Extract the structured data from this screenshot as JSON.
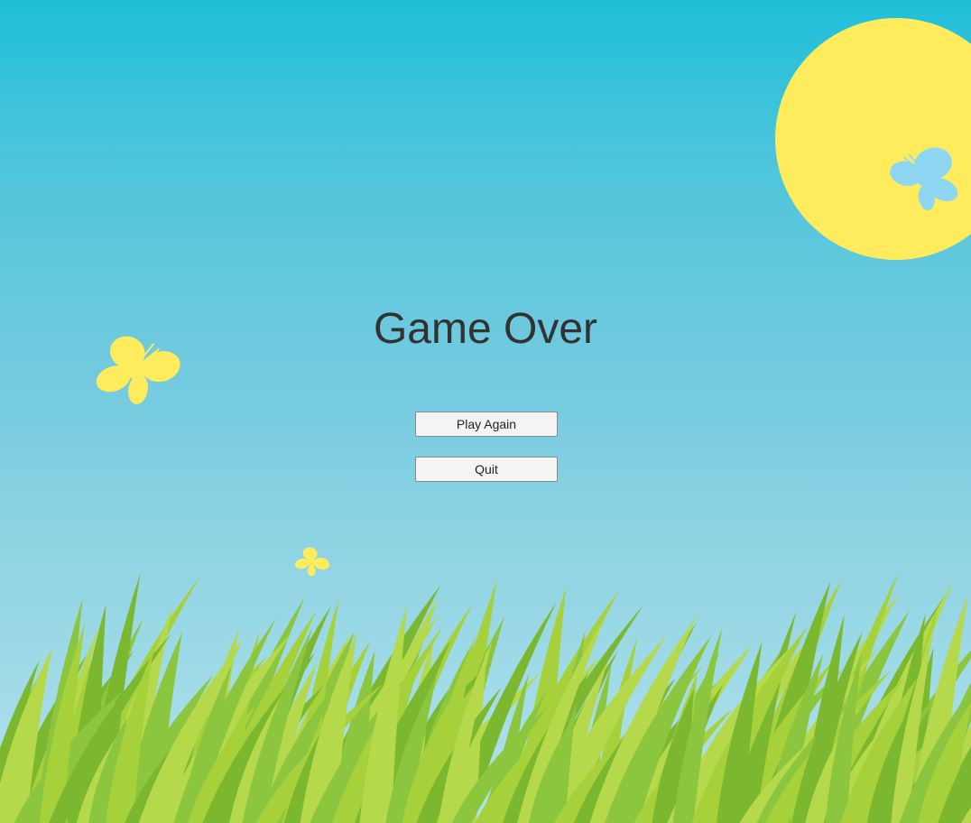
{
  "screen": {
    "title": "Game Over"
  },
  "menu": {
    "play_again_label": "Play Again",
    "quit_label": "Quit"
  },
  "scene": {
    "sky_top_color": "#1fbfd9",
    "sky_bottom_color": "#b2e3ec",
    "sun_color": "#ffec5c",
    "grass_colors": [
      "#8cc63f",
      "#a6d13a",
      "#7cb82f",
      "#b5d94a"
    ],
    "butterflies": [
      {
        "name": "butterfly-blue",
        "color": "#8fd6f2"
      },
      {
        "name": "butterfly-yellow-large",
        "color": "#ffec5c"
      },
      {
        "name": "butterfly-yellow-small",
        "color": "#ffec5c"
      }
    ]
  }
}
